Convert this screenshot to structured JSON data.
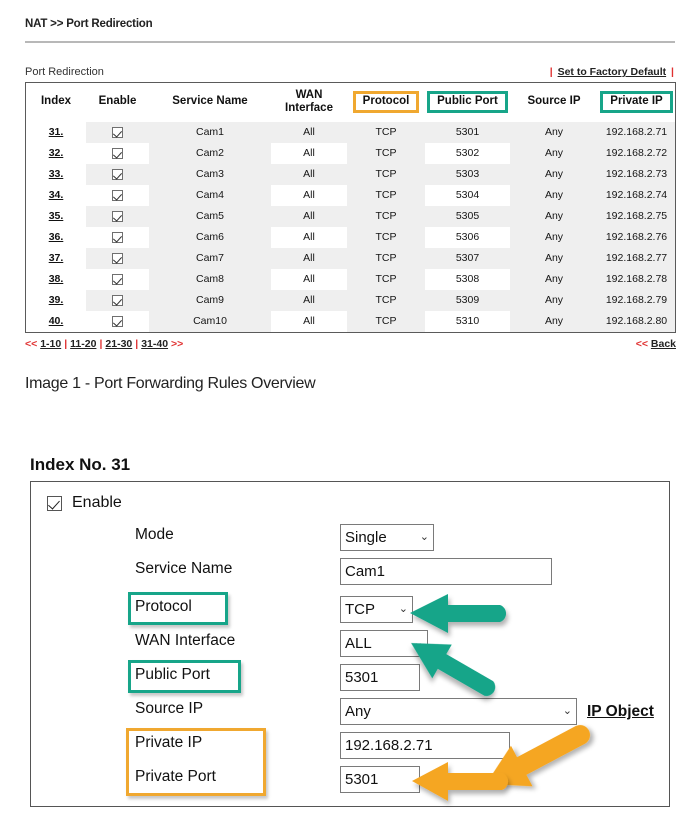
{
  "breadcrumb": "NAT >> Port Redirection",
  "panel": {
    "title": "Port Redirection",
    "factory_label": "Set to Factory Default",
    "pipe": "|"
  },
  "table": {
    "headers": [
      "Index",
      "Enable",
      "Service Name",
      "WAN Interface",
      "Protocol",
      "Public Port",
      "Source IP",
      "Private IP"
    ],
    "header_wan_line1": "WAN",
    "header_wan_line2": "Interface",
    "rows": [
      {
        "index": "31.",
        "enable": true,
        "service": "Cam1",
        "wan": "All",
        "protocol": "TCP",
        "public_port": "5301",
        "source_ip": "Any",
        "private_ip": "192.168.2.71"
      },
      {
        "index": "32.",
        "enable": true,
        "service": "Cam2",
        "wan": "All",
        "protocol": "TCP",
        "public_port": "5302",
        "source_ip": "Any",
        "private_ip": "192.168.2.72"
      },
      {
        "index": "33.",
        "enable": true,
        "service": "Cam3",
        "wan": "All",
        "protocol": "TCP",
        "public_port": "5303",
        "source_ip": "Any",
        "private_ip": "192.168.2.73"
      },
      {
        "index": "34.",
        "enable": true,
        "service": "Cam4",
        "wan": "All",
        "protocol": "TCP",
        "public_port": "5304",
        "source_ip": "Any",
        "private_ip": "192.168.2.74"
      },
      {
        "index": "35.",
        "enable": true,
        "service": "Cam5",
        "wan": "All",
        "protocol": "TCP",
        "public_port": "5305",
        "source_ip": "Any",
        "private_ip": "192.168.2.75"
      },
      {
        "index": "36.",
        "enable": true,
        "service": "Cam6",
        "wan": "All",
        "protocol": "TCP",
        "public_port": "5306",
        "source_ip": "Any",
        "private_ip": "192.168.2.76"
      },
      {
        "index": "37.",
        "enable": true,
        "service": "Cam7",
        "wan": "All",
        "protocol": "TCP",
        "public_port": "5307",
        "source_ip": "Any",
        "private_ip": "192.168.2.77"
      },
      {
        "index": "38.",
        "enable": true,
        "service": "Cam8",
        "wan": "All",
        "protocol": "TCP",
        "public_port": "5308",
        "source_ip": "Any",
        "private_ip": "192.168.2.78"
      },
      {
        "index": "39.",
        "enable": true,
        "service": "Cam9",
        "wan": "All",
        "protocol": "TCP",
        "public_port": "5309",
        "source_ip": "Any",
        "private_ip": "192.168.2.79"
      },
      {
        "index": "40.",
        "enable": true,
        "service": "Cam10",
        "wan": "All",
        "protocol": "TCP",
        "public_port": "5310",
        "source_ip": "Any",
        "private_ip": "192.168.2.80"
      }
    ]
  },
  "pager": {
    "prev_arrow": "<<",
    "next_arrow": ">>",
    "pages": [
      "1-10",
      "11-20",
      "21-30",
      "31-40"
    ],
    "back_arrow": "<<",
    "back_label": "Back"
  },
  "caption": "Image 1 - Port Forwarding Rules Overview",
  "detail": {
    "index_title": "Index No. 31",
    "enable_label": "Enable",
    "fields": {
      "mode": {
        "label": "Mode",
        "value": "Single"
      },
      "service_name": {
        "label": "Service Name",
        "value": "Cam1"
      },
      "protocol": {
        "label": "Protocol",
        "value": "TCP"
      },
      "wan_interface": {
        "label": "WAN Interface",
        "value": "ALL"
      },
      "public_port": {
        "label": "Public Port",
        "value": "5301"
      },
      "source_ip": {
        "label": "Source IP",
        "value": "Any"
      },
      "private_ip": {
        "label": "Private IP",
        "value": "192.168.2.71"
      },
      "private_port": {
        "label": "Private Port",
        "value": "5301"
      }
    },
    "ip_object_link": "IP Object",
    "chevron": "⌄"
  },
  "colors": {
    "highlight_teal": "#17a589",
    "highlight_orange": "#f0a830",
    "link_red": "#e03030",
    "row_shade": "#efefef"
  }
}
